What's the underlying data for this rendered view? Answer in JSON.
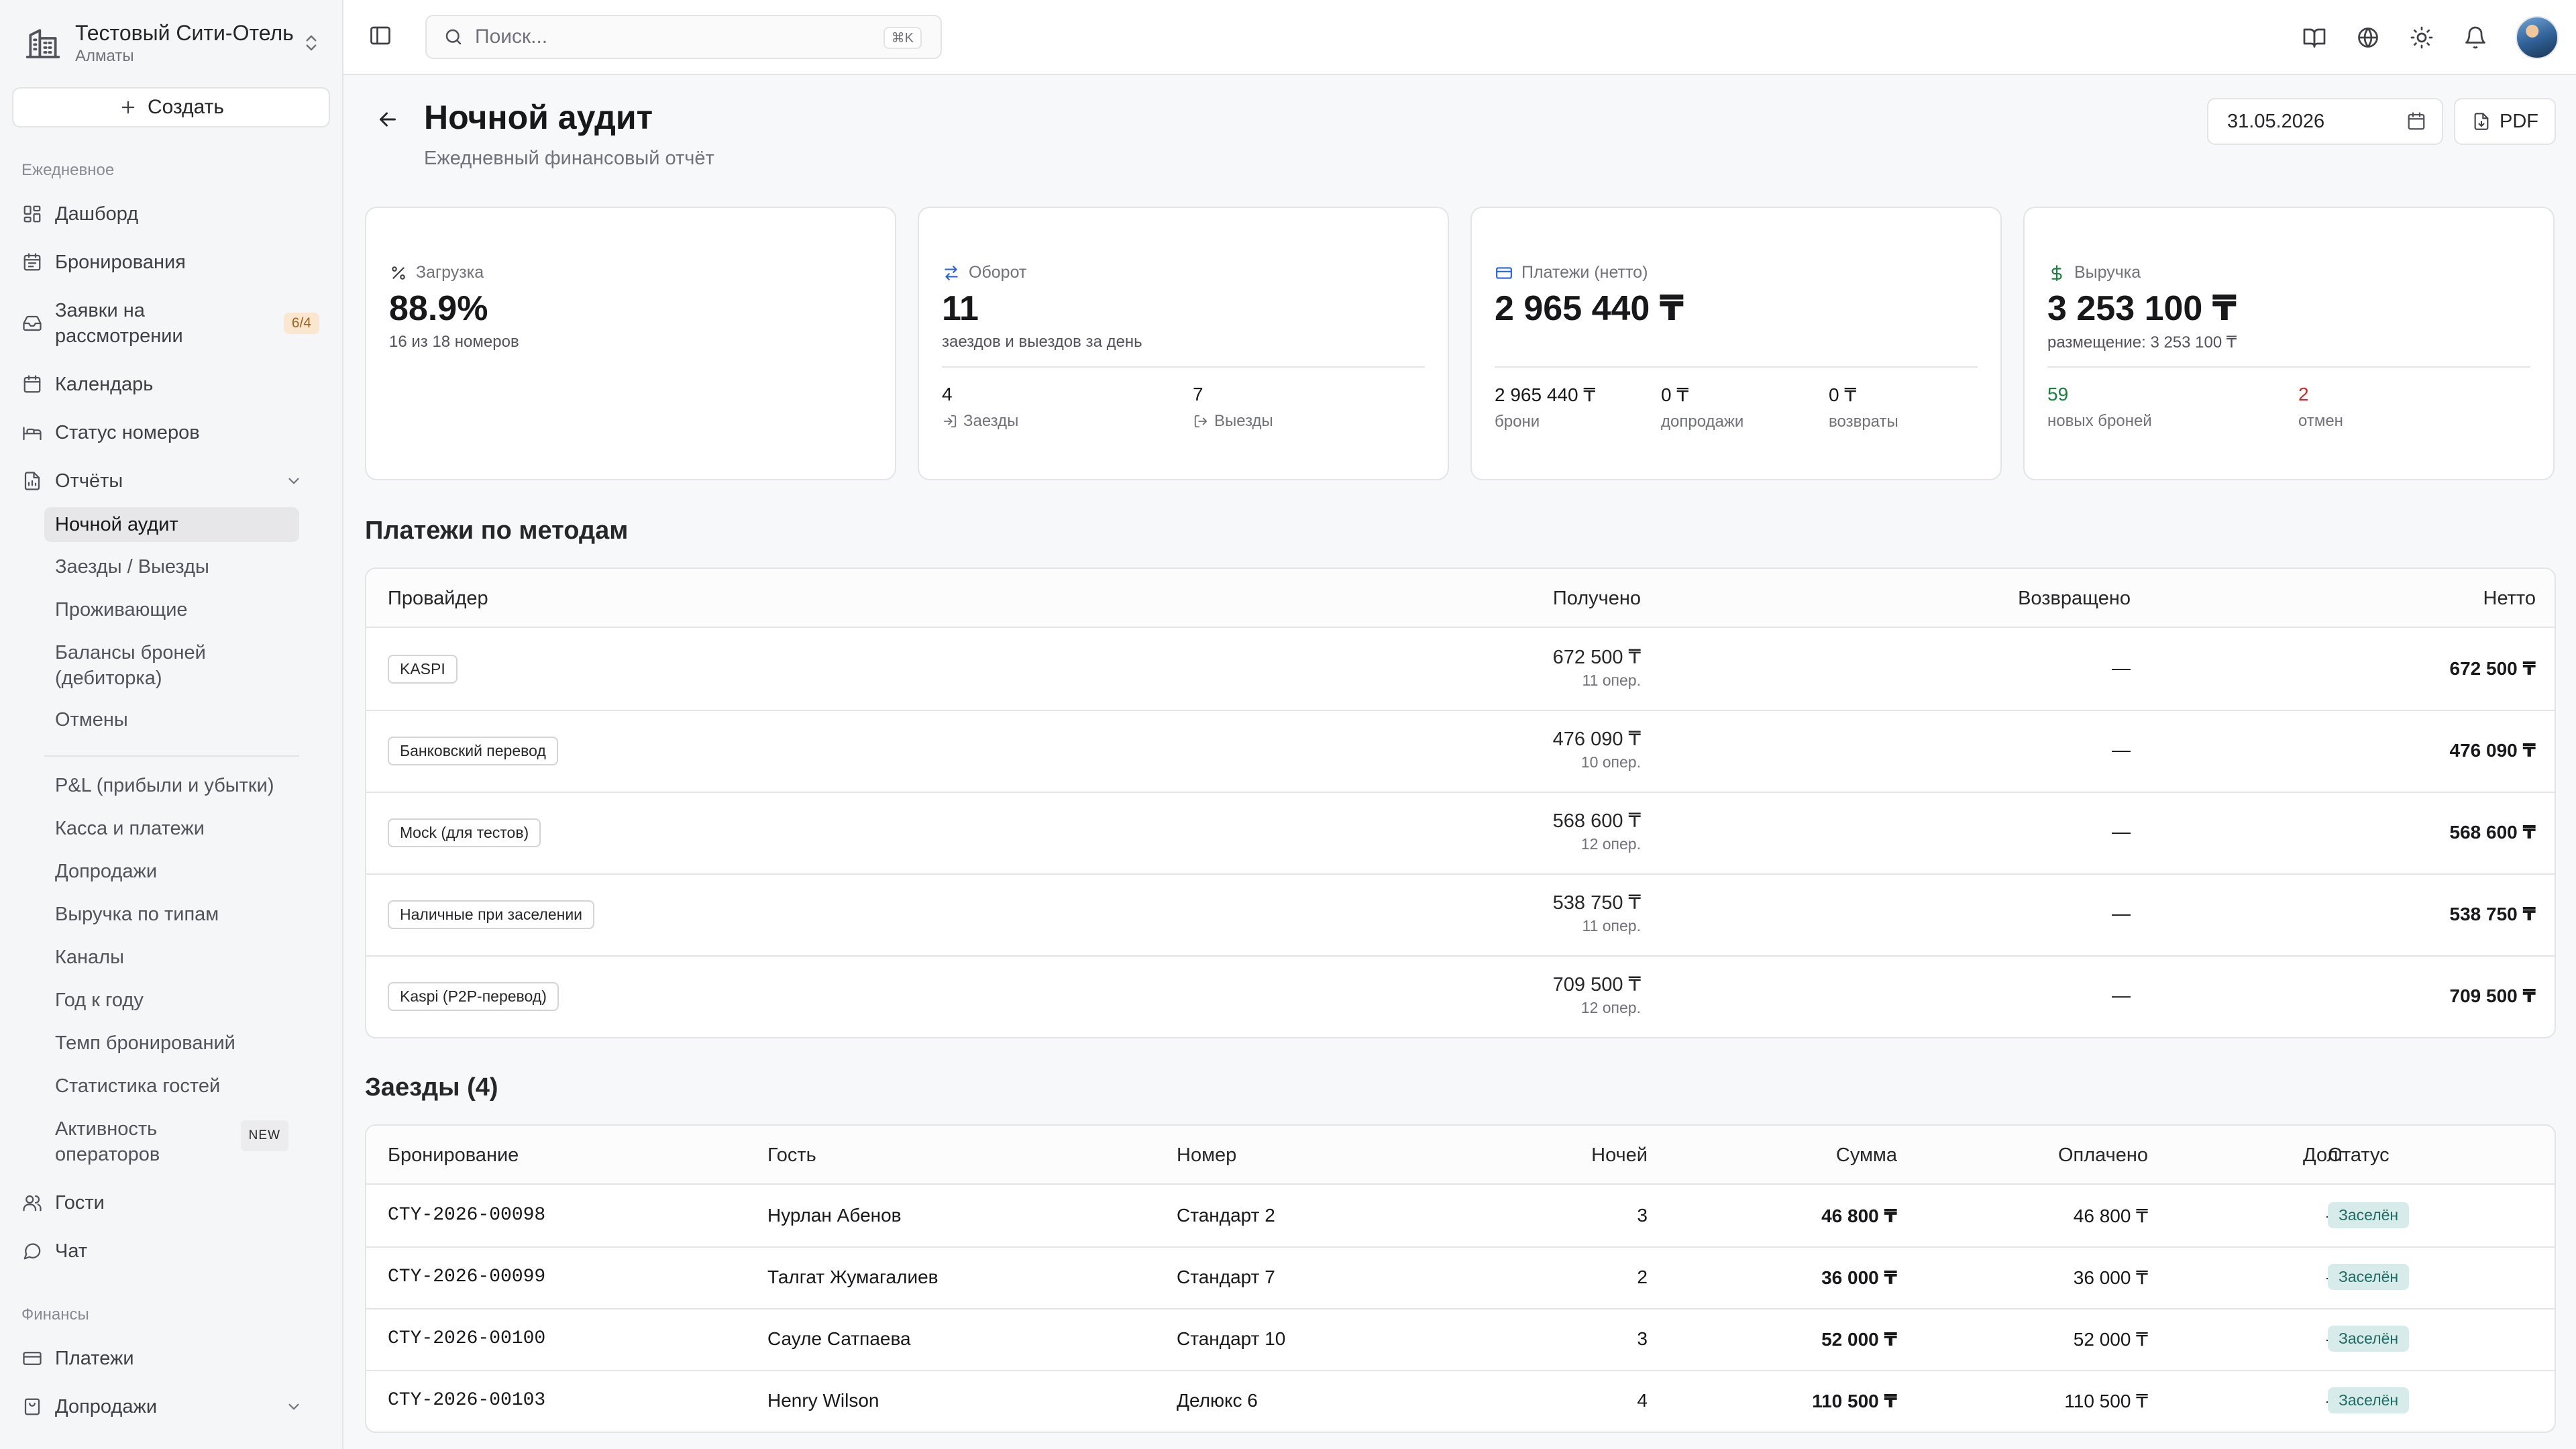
{
  "org": {
    "name": "Тестовый Сити-Отель",
    "city": "Алматы"
  },
  "sidebar": {
    "create_label": "Создать",
    "daily_label": "Ежедневное",
    "finance_label": "Финансы",
    "items": [
      {
        "label": "Дашборд",
        "icon": "dashboard-icon"
      },
      {
        "label": "Бронирования",
        "icon": "calendar-list-icon"
      },
      {
        "label": "Заявки на рассмотрении",
        "icon": "inbox-icon",
        "badge": "6/4"
      },
      {
        "label": "Календарь",
        "icon": "calendar-icon"
      },
      {
        "label": "Статус номеров",
        "icon": "bed-icon"
      },
      {
        "label": "Отчёты",
        "icon": "report-icon"
      }
    ],
    "reports": [
      {
        "label": "Ночной аудит"
      },
      {
        "label": "Заезды / Выезды"
      },
      {
        "label": "Проживающие"
      },
      {
        "label": "Балансы броней (дебиторка)"
      },
      {
        "label": "Отмены"
      },
      {
        "label": "P&L (прибыли и убытки)"
      },
      {
        "label": "Касса и платежи"
      },
      {
        "label": "Допродажи"
      },
      {
        "label": "Выручка по типам"
      },
      {
        "label": "Каналы"
      },
      {
        "label": "Год к году"
      },
      {
        "label": "Темп бронирований"
      },
      {
        "label": "Статистика гостей"
      },
      {
        "label": "Активность операторов",
        "badge": "NEW"
      }
    ],
    "bottom_items": [
      {
        "label": "Гости"
      },
      {
        "label": "Чат"
      }
    ],
    "finance_items": [
      {
        "label": "Платежи"
      },
      {
        "label": "Допродажи"
      }
    ]
  },
  "topbar": {
    "search_placeholder": "Поиск...",
    "search_shortcut": "⌘K"
  },
  "header": {
    "title": "Ночной аудит",
    "subtitle": "Ежедневный финансовый отчёт",
    "date": "31.05.2026",
    "pdf_label": "PDF"
  },
  "kpi": {
    "occupancy": {
      "label": "Загрузка",
      "value": "88.9%",
      "sub": "16 из 18 номеров"
    },
    "turnover": {
      "label": "Оборот",
      "value": "11",
      "sub": "заездов и выездов за день",
      "arrivals_value": "4",
      "arrivals_label": "Заезды",
      "departures_value": "7",
      "departures_label": "Выезды"
    },
    "payments": {
      "label": "Платежи (нетто)",
      "value": "2 965 440 ₸",
      "bookings_value": "2 965 440 ₸",
      "bookings_label": "брони",
      "upsell_value": "0 ₸",
      "upsell_label": "допродажи",
      "refunds_value": "0 ₸",
      "refunds_label": "возвраты"
    },
    "revenue": {
      "label": "Выручка",
      "value": "3 253 100 ₸",
      "sub": "размещение: 3 253 100 ₸",
      "new_value": "59",
      "new_label": "новых броней",
      "cancel_value": "2",
      "cancel_label": "отмен"
    }
  },
  "payments_section": {
    "title": "Платежи по методам",
    "columns": [
      "Провайдер",
      "Получено",
      "Возвращено",
      "Нетто"
    ],
    "rows": [
      {
        "provider": "KASPI",
        "received": "672 500 ₸",
        "ops": "11 опер.",
        "refunded": "—",
        "net": "672 500 ₸"
      },
      {
        "provider": "Банковский перевод",
        "received": "476 090 ₸",
        "ops": "10 опер.",
        "refunded": "—",
        "net": "476 090 ₸"
      },
      {
        "provider": "Mock (для тестов)",
        "received": "568 600 ₸",
        "ops": "12 опер.",
        "refunded": "—",
        "net": "568 600 ₸"
      },
      {
        "provider": "Наличные при заселении",
        "received": "538 750 ₸",
        "ops": "11 опер.",
        "refunded": "—",
        "net": "538 750 ₸"
      },
      {
        "provider": "Kaspi (P2P-перевод)",
        "received": "709 500 ₸",
        "ops": "12 опер.",
        "refunded": "—",
        "net": "709 500 ₸"
      }
    ]
  },
  "arrivals_section": {
    "title": "Заезды (4)",
    "columns": [
      "Бронирование",
      "Гость",
      "Номер",
      "Ночей",
      "Сумма",
      "Оплачено",
      "Долг",
      "Статус"
    ],
    "rows": [
      {
        "booking": "CTY-2026-00098",
        "guest": "Нурлан Абенов",
        "room": "Стандарт 2",
        "nights": "3",
        "amount": "46 800 ₸",
        "paid": "46 800 ₸",
        "debt": "—",
        "status": "Заселён"
      },
      {
        "booking": "CTY-2026-00099",
        "guest": "Талгат Жумагалиев",
        "room": "Стандарт 7",
        "nights": "2",
        "amount": "36 000 ₸",
        "paid": "36 000 ₸",
        "debt": "—",
        "status": "Заселён"
      },
      {
        "booking": "CTY-2026-00100",
        "guest": "Сауле Сатпаева",
        "room": "Стандарт 10",
        "nights": "3",
        "amount": "52 000 ₸",
        "paid": "52 000 ₸",
        "debt": "—",
        "status": "Заселён"
      },
      {
        "booking": "CTY-2026-00103",
        "guest": "Henry Wilson",
        "room": "Делюкс 6",
        "nights": "4",
        "amount": "110 500 ₸",
        "paid": "110 500 ₸",
        "debt": "—",
        "status": "Заселён"
      }
    ]
  },
  "colors": {
    "accent_green": "#16803c",
    "accent_red": "#dc2626",
    "status_bg": "#d7ecea",
    "badge_bg": "#fbe7cf"
  }
}
